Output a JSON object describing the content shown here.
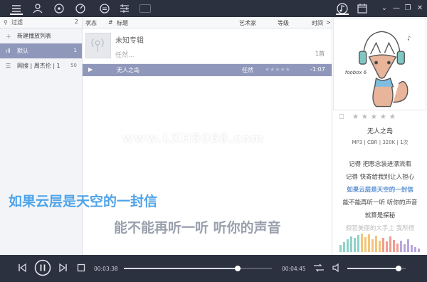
{
  "left_panel": {
    "filter_label": "过滤",
    "filter_count": "2",
    "items": [
      {
        "label": "新建播放列表",
        "count": ""
      },
      {
        "label": "默认",
        "count": "1"
      },
      {
        "label": "网搜 | 周杰伦 | 1",
        "count": "50"
      }
    ]
  },
  "columns": {
    "status": "状态",
    "num": "#",
    "title": "标题",
    "artist": "艺术家",
    "grade": "等级",
    "time": "时间",
    "more": ">"
  },
  "album": {
    "title": "未知专辑",
    "artist": "任然...",
    "count": "1首"
  },
  "track": {
    "title": "无人之岛",
    "artist": "任然",
    "time": "-1:07"
  },
  "now_playing": {
    "title": "无人之岛",
    "meta": "MP3 | CBR | 320K | 1次",
    "art_caption": "foobox 6",
    "rating_stars": "★★★★★"
  },
  "lyrics": [
    {
      "text": "记得 把思念装进漂流瓶",
      "current": false
    },
    {
      "text": "记得 快寄给我别让人担心",
      "current": false
    },
    {
      "text": "如果云层是天空的一封信",
      "current": true
    },
    {
      "text": "能不能再听一听 听你的声音",
      "current": false
    },
    {
      "text": "就算是探秘",
      "current": false
    },
    {
      "text": "假若美丽的大手上 我所得",
      "current": false
    }
  ],
  "playback": {
    "elapsed": "00:03:38",
    "total": "00:04:45",
    "progress": 0.77,
    "volume": 0.88
  },
  "watermark": "www.LXH5068.com",
  "desktop_lyrics": {
    "line1": "如果云层是天空的一封信",
    "line2": "能不能再听一听  听你的声音"
  },
  "colors": {
    "accent": "#8f98bb",
    "bar": "#2c3140",
    "lyric_current": "#5b8fcf"
  }
}
